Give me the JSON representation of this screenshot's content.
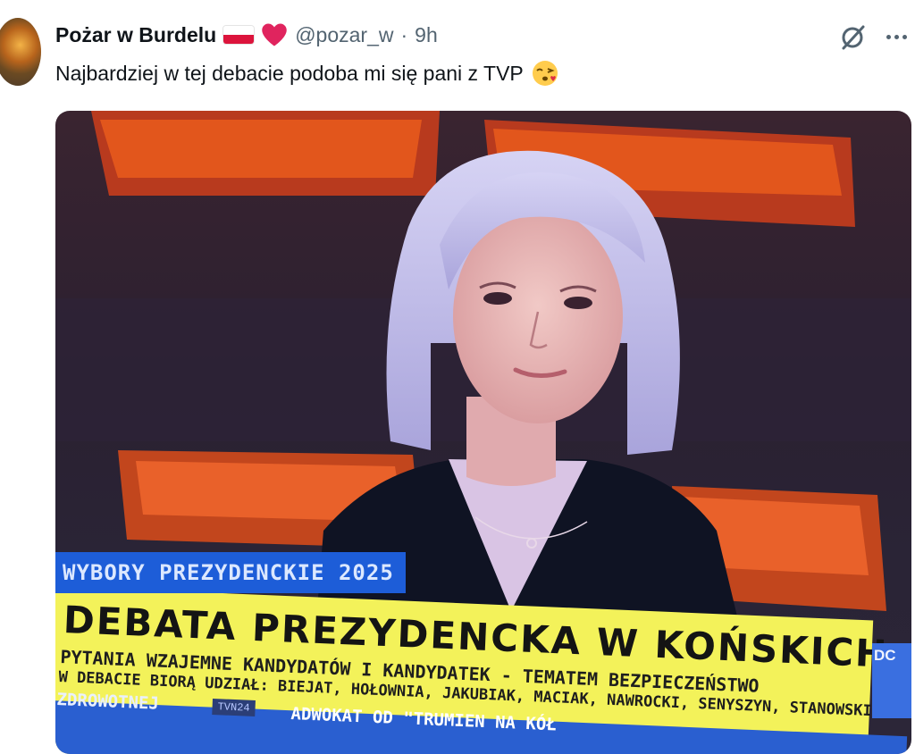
{
  "tweet": {
    "author_name": "Pożar w Burdelu",
    "handle": "@pozar_w",
    "separator": "·",
    "time": "9h",
    "text": "Najbardziej w tej debacie podoba mi się pani z TVP",
    "emoji_icon": "kissing-face-emoji",
    "flag_icon": "poland-flag-icon",
    "heart_color": "#e0245e"
  },
  "media": {
    "ticker_tag": "WYBORY PREZYDENCKIE 2025",
    "headline": "DEBATA PREZYDENCKA W KOŃSKICH",
    "subline1": "PYTANIA WZAJEMNE KANDYDATÓW I KANDYDATEK - TEMATEM BEZPIECZEŃSTWO",
    "subline2": "W DEBACIE BIORĄ UDZIAŁ: BIEJAT, HOŁOWNIA, JAKUBIAK, MACIAK, NAWROCKI, SENYSZYN, STANOWSKI, TRZA",
    "bottom_left": "ZDROWOTNEJ",
    "channel_logo": "TVN24",
    "bottom_right": "ADWOKAT OD \"TRUMIEN NA KÓŁ",
    "side_text": "DC",
    "colors": {
      "ticker_blue": "#1d5dd8",
      "band_yellow": "#f3f25a",
      "seat_orange": "#e2561c"
    }
  }
}
